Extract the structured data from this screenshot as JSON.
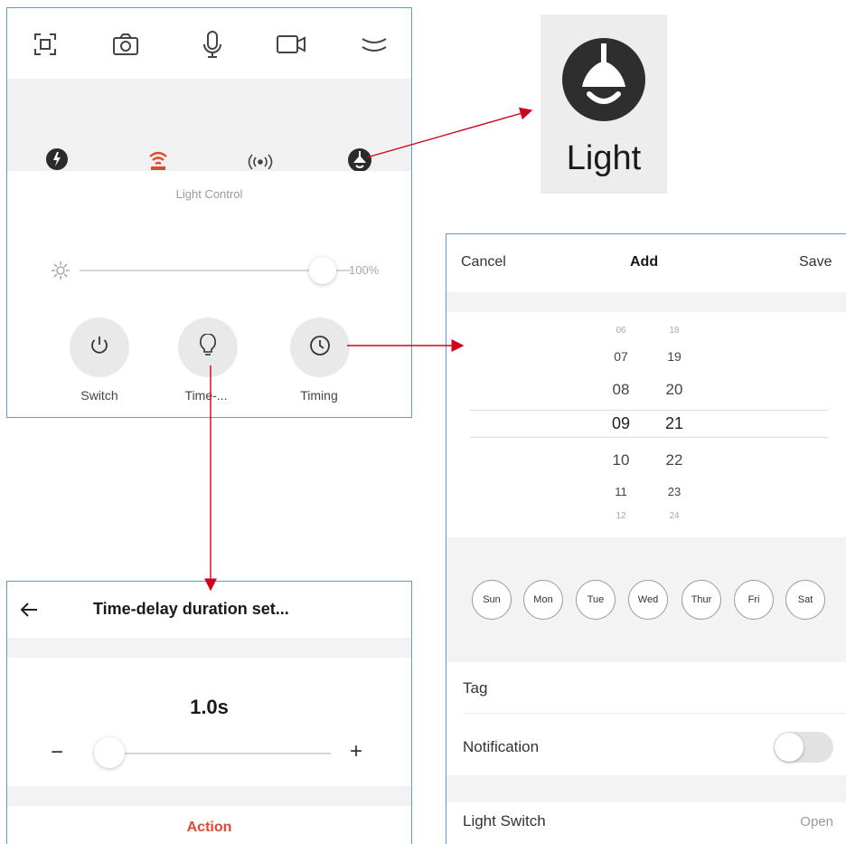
{
  "colors": {
    "accent_red": "#e0482f",
    "arrow_red": "#d0021b",
    "panel_border": "#5b9bd5"
  },
  "control_panel": {
    "toolbar_icons": [
      "screenshot-icon",
      "camera-icon",
      "microphone-icon",
      "video-icon",
      "collapse-icon"
    ],
    "mode_icons": [
      "mode-icon-1",
      "mode-icon-2-active",
      "wireless-signal-icon",
      "light-icon"
    ],
    "section_title": "Light Control",
    "brightness": {
      "value_percent": 100,
      "label": "100%"
    },
    "buttons": [
      {
        "label": "Switch",
        "icon": "power-icon"
      },
      {
        "label": "Time-...",
        "icon": "bulb-icon"
      },
      {
        "label": "Timing",
        "icon": "clock-icon"
      }
    ]
  },
  "light_preview": {
    "label": "Light",
    "icon": "light-icon"
  },
  "add_timer": {
    "cancel": "Cancel",
    "title": "Add",
    "save": "Save",
    "hours": [
      "06",
      "07",
      "08",
      "09",
      "10",
      "11",
      "12"
    ],
    "minutes": [
      "18",
      "19",
      "20",
      "21",
      "22",
      "23",
      "24"
    ],
    "selected_hour": "09",
    "selected_minute": "21",
    "days": [
      "Sun",
      "Mon",
      "Tue",
      "Wed",
      "Thur",
      "Fri",
      "Sat"
    ],
    "tag_label": "Tag",
    "notification_label": "Notification",
    "notification_on": false,
    "light_switch_label": "Light Switch",
    "light_switch_value": "Open"
  },
  "time_delay": {
    "title": "Time-delay duration set...",
    "value": "1.0s",
    "slider_fraction": 0,
    "minus": "−",
    "plus": "+",
    "action": "Action"
  }
}
